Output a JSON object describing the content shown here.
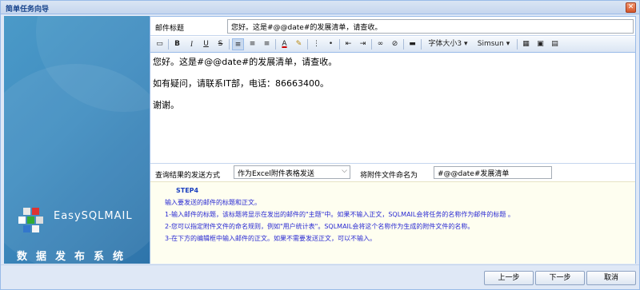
{
  "window": {
    "title": "简单任务向导"
  },
  "left_panel": {
    "brand": "EasySQLMAIL",
    "brand_sub": "数据发布系统"
  },
  "subject": {
    "label": "邮件标题",
    "value": "您好。这是#@@date#的发展清单，请查收。"
  },
  "toolbar": {
    "bold": "B",
    "italic": "I",
    "underline": "U",
    "strike": "S",
    "font_size": "字体大小3",
    "font_family": "Simsun"
  },
  "editor": {
    "lines": [
      "您好。这是#@@date#的发展清单，请查收。",
      "如有疑问，请联系IT部，电话：86663400。",
      "谢谢。"
    ]
  },
  "options": {
    "send_mode_label": "查询结果的发送方式",
    "send_mode_value": "作为Excel附件表格发送",
    "attach_name_label": "将附件文件命名为",
    "attach_name_value": "#@@date#发展清单"
  },
  "help": {
    "step": "STEP4",
    "lines": [
      "输入要发送的邮件的标题和正文。",
      "1-输入邮件的标题，该标题将显示在发出的邮件的\"主题\"中。如果不输入正文，SQLMAIL会将任务的名称作为邮件的标题 。",
      "2-您可以指定附件文件的命名规则，例如\"用户统计表\"。SQLMAIL会将这个名称作为生成的附件文件的名称。",
      "3-在下方的编辑框中输入邮件的正文。如果不需要发送正文，可以不输入。"
    ]
  },
  "footer": {
    "prev": "上一步",
    "next": "下一步",
    "cancel": "取消"
  }
}
